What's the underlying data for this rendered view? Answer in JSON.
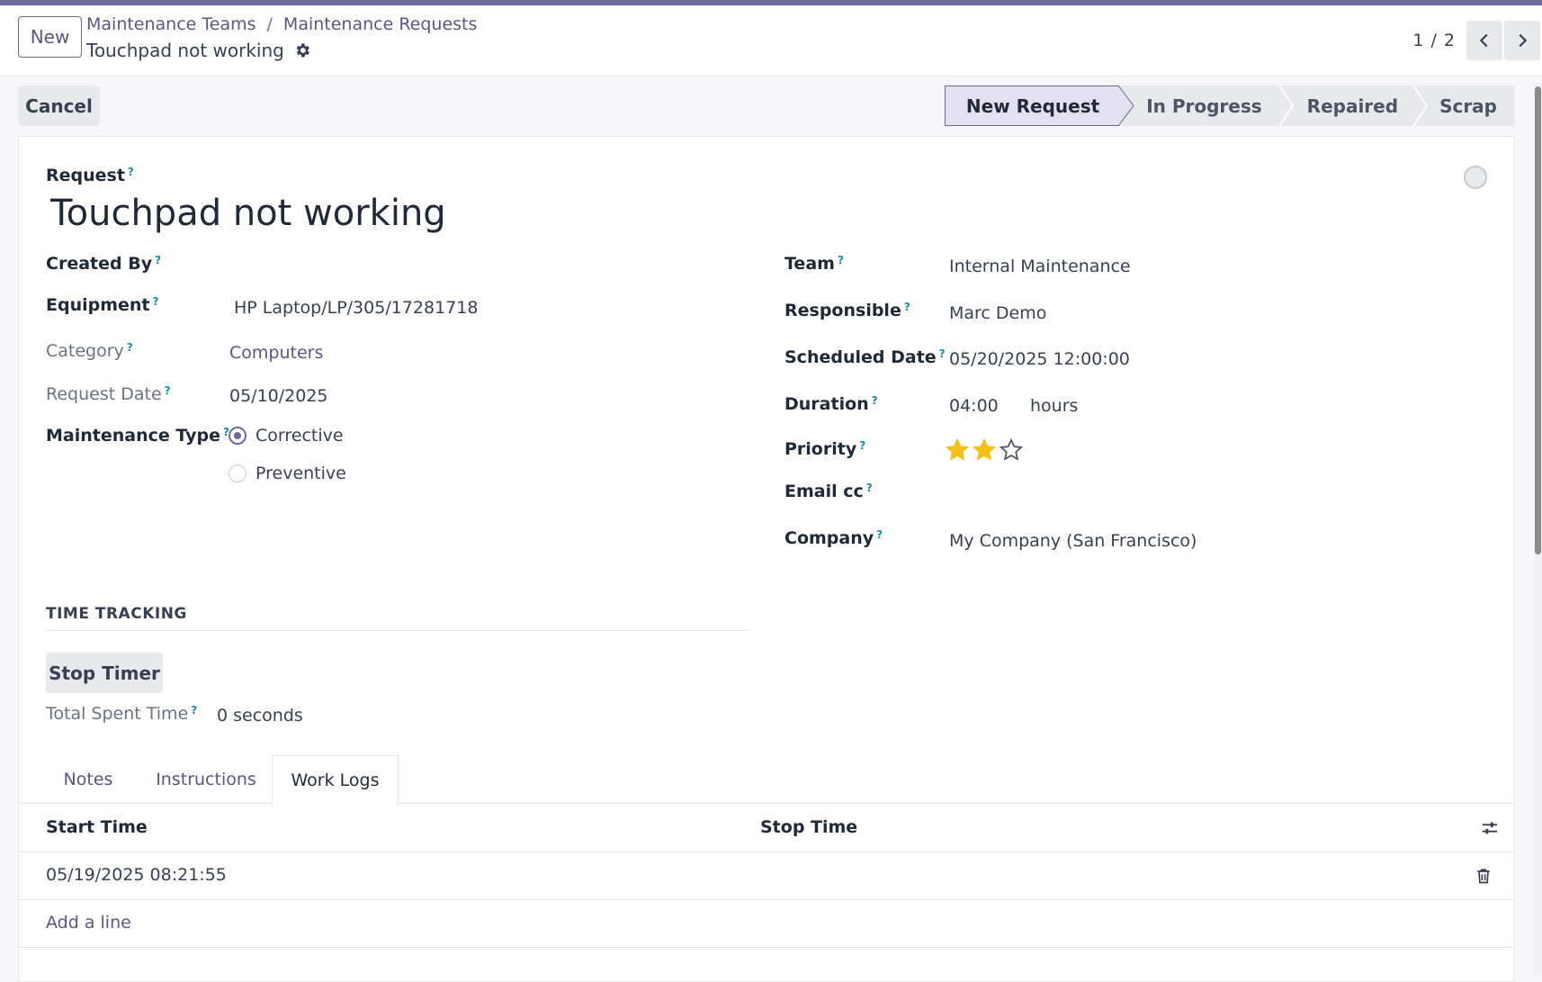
{
  "header": {
    "new_label": "New",
    "breadcrumb": [
      "Maintenance Teams",
      "Maintenance Requests"
    ],
    "breadcrumb_sep": "/",
    "record_title": "Touchpad not working",
    "pager": "1 / 2"
  },
  "actions": {
    "cancel_label": "Cancel",
    "stages": [
      "New Request",
      "In Progress",
      "Repaired",
      "Scrap"
    ],
    "active_stage": "New Request"
  },
  "form": {
    "request_label": "Request",
    "request_title": "Touchpad not working",
    "left": {
      "created_by_label": "Created By",
      "equipment_label": "Equipment",
      "equipment_value": "HP Laptop/LP/305/17281718",
      "category_label": "Category",
      "category_value": "Computers",
      "request_date_label": "Request Date",
      "request_date_value": "05/10/2025",
      "maintenance_type_label": "Maintenance Type",
      "maintenance_options": [
        "Corrective",
        "Preventive"
      ],
      "maintenance_selected": "Corrective"
    },
    "right": {
      "team_label": "Team",
      "team_value": "Internal Maintenance",
      "responsible_label": "Responsible",
      "responsible_value": "Marc Demo",
      "scheduled_label": "Scheduled Date",
      "scheduled_value": "05/20/2025 12:00:00",
      "duration_label": "Duration",
      "duration_value": "04:00",
      "duration_unit": "hours",
      "priority_label": "Priority",
      "priority_stars": 2,
      "priority_max": 3,
      "email_cc_label": "Email cc",
      "company_label": "Company",
      "company_value": "My Company (San Francisco)"
    },
    "time_tracking": {
      "section_title": "TIME TRACKING",
      "stop_timer_label": "Stop Timer",
      "total_spent_label": "Total Spent Time",
      "total_spent_value": "0 seconds"
    },
    "tabs": [
      "Notes",
      "Instructions",
      "Work Logs"
    ],
    "active_tab": "Work Logs",
    "work_logs": {
      "columns": [
        "Start Time",
        "Stop Time"
      ],
      "rows": [
        {
          "start": "05/19/2025 08:21:55",
          "stop": ""
        }
      ],
      "add_line_label": "Add a line"
    }
  },
  "help_marker": "?",
  "colors": {
    "accent": "#6f6a9e",
    "link": "#5b557f",
    "star": "#f3c014",
    "help": "#1a8ca3"
  }
}
